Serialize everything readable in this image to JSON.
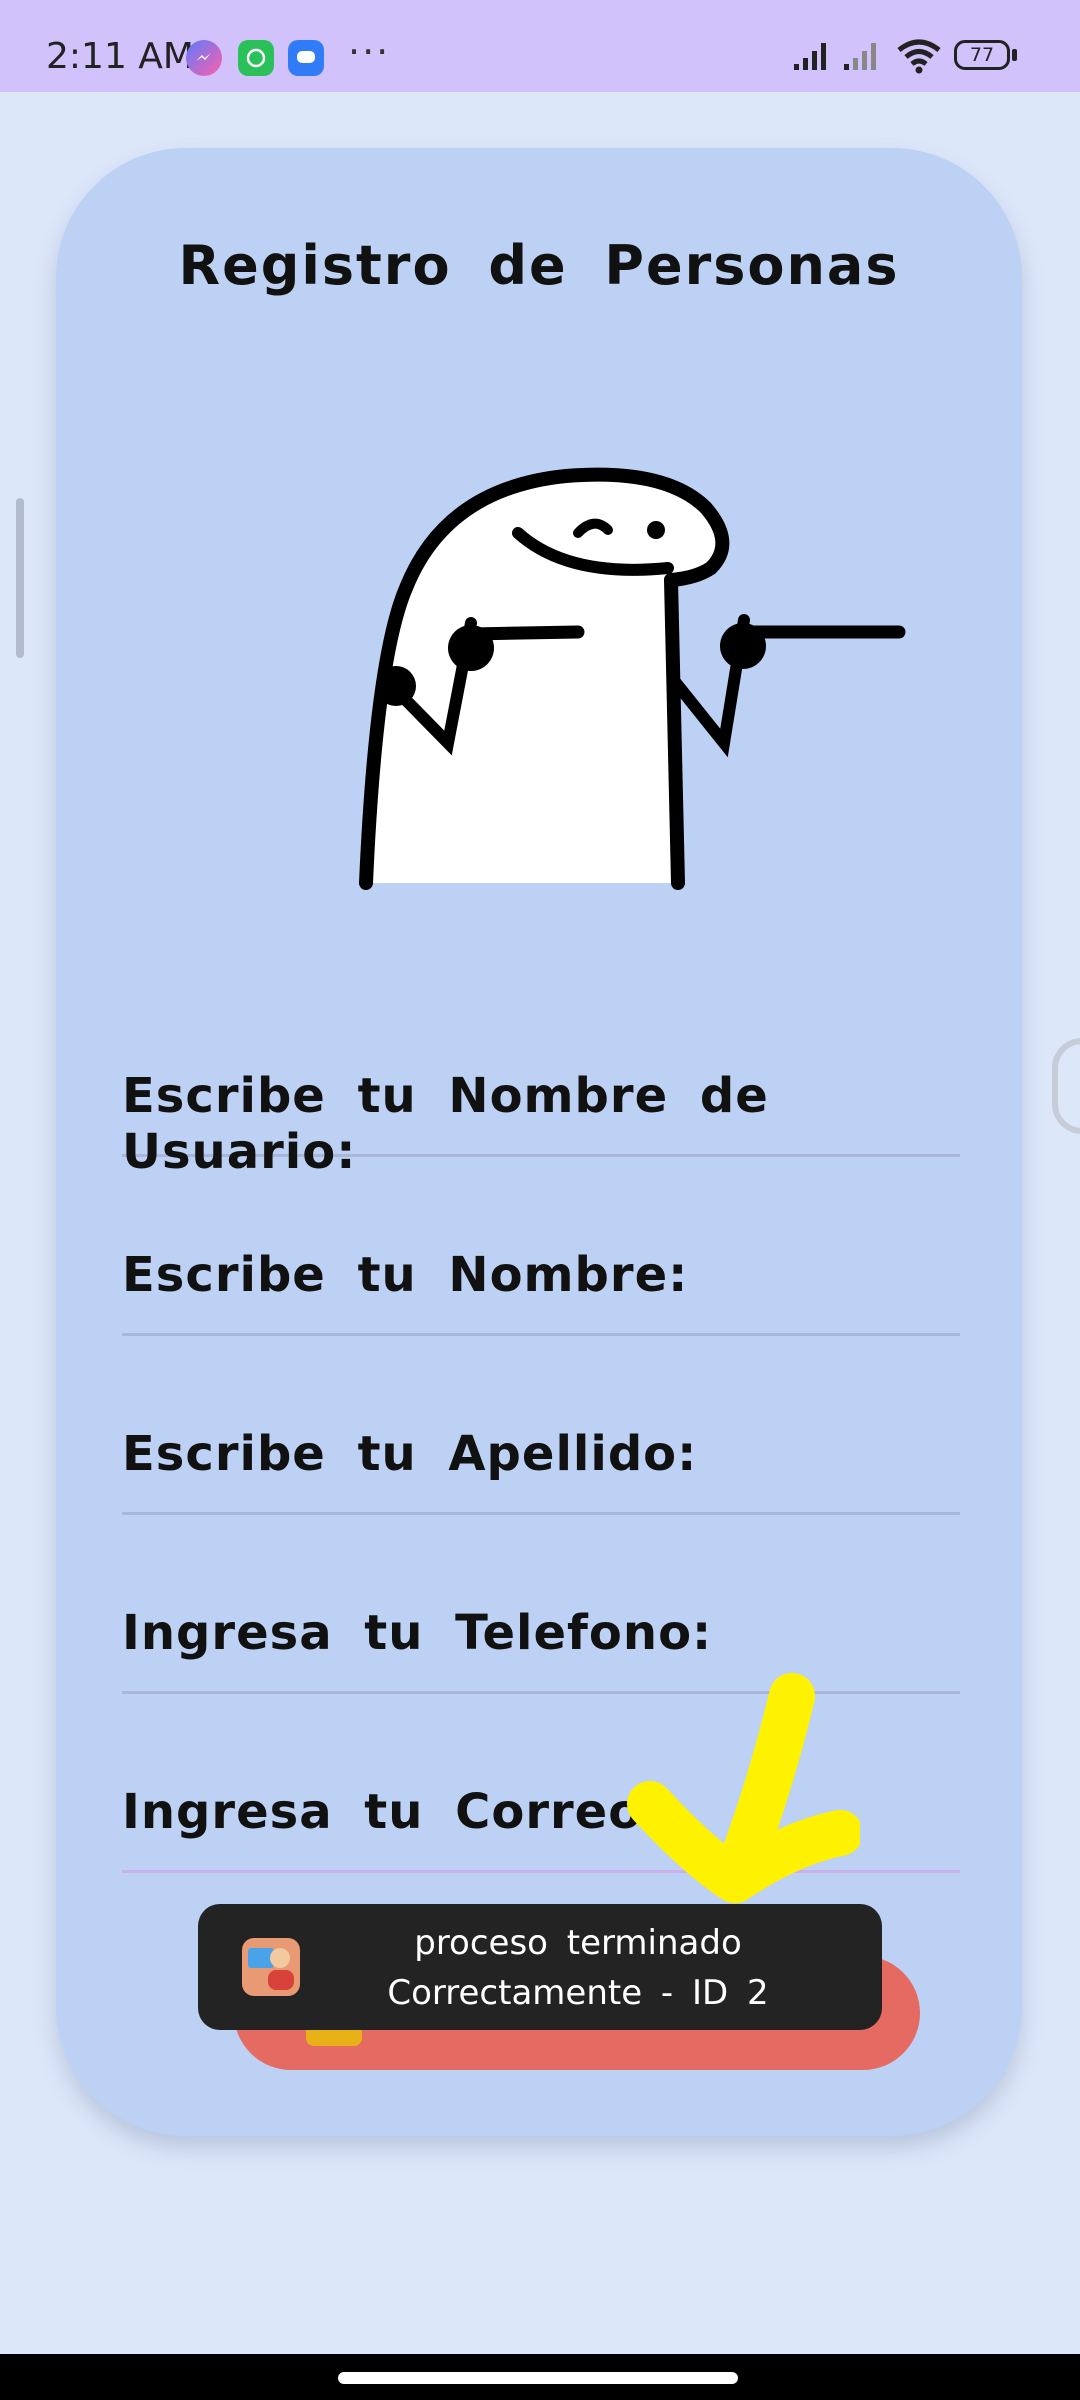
{
  "status_bar": {
    "time": "2:11 AM",
    "more": "···",
    "battery": "77"
  },
  "form": {
    "title": "Registro de Personas",
    "fields": [
      {
        "label": "Escribe tu Nombre de Usuario:"
      },
      {
        "label": "Escribe tu Nombre:"
      },
      {
        "label": "Escribe tu Apellido:"
      },
      {
        "label": "Ingresa tu Telefono:"
      },
      {
        "label": "Ingresa tu Correo:"
      }
    ]
  },
  "toast": {
    "line1": "proceso terminado",
    "line2": "Correctamente - ID 2"
  },
  "colors": {
    "card": "#bcd1f4",
    "button": "#e46a62",
    "status_bar": "#d2c2fb",
    "annotation": "#fff200"
  }
}
